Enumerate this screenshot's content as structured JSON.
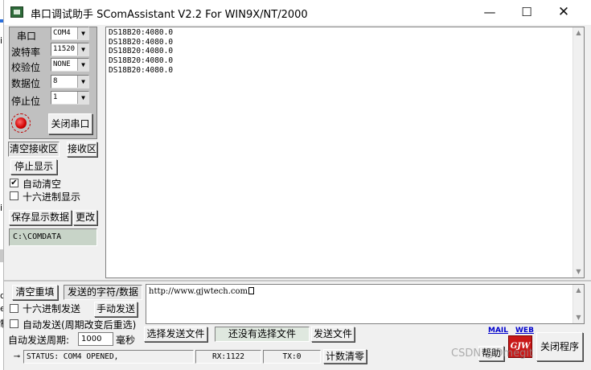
{
  "window": {
    "title": "串口调试助手 SComAssistant V2.2 For WIN9X/NT/2000",
    "minimize": "—",
    "maximize": "☐",
    "close": "✕"
  },
  "background": {
    "frag1": "i",
    "frag2": "i",
    "frag3": "d",
    "frag4": "e",
    "frag5": "制"
  },
  "serial": {
    "port_label": "串口",
    "port_value": "COM4",
    "baud_label": "波特率",
    "baud_value": "11520",
    "parity_label": "校验位",
    "parity_value": "NONE",
    "databits_label": "数据位",
    "databits_value": "8",
    "stopbits_label": "停止位",
    "stopbits_value": "1",
    "toggle_port_button": "关闭串口",
    "led_color": "#e00000"
  },
  "receive": {
    "clear_button": "清空接收区",
    "receive_area_button": "接收区",
    "stop_display_button": "停止显示",
    "auto_clear_label": "自动清空",
    "auto_clear_checked": true,
    "hex_display_label": "十六进制显示",
    "hex_display_checked": false,
    "save_button": "保存显示数据",
    "change_button": "更改",
    "save_path": "C:\\COMDATA",
    "lines": [
      "DS18B20:4080.0",
      "DS18B20:4080.0",
      "DS18B20:4080.0",
      "DS18B20:4080.0",
      "DS18B20:4080.0"
    ]
  },
  "send": {
    "clear_resend_button": "清空重填",
    "send_data_button": "发送的字符/数据",
    "hex_send_label": "十六进制发送",
    "manual_send_button": "手动发送",
    "auto_send_label": "自动发送(周期改变后重选)",
    "period_label": "自动发送周期:",
    "period_value": "1000",
    "period_unit": "毫秒",
    "choose_file_button": "选择发送文件",
    "no_file_text": "还没有选择文件",
    "send_file_button": "发送文件",
    "send_text": "http://www.gjwtech.com"
  },
  "links": {
    "mail": "MAIL",
    "web": "WEB"
  },
  "help_button": "帮助",
  "close_program_button": "关闭程序",
  "logo_text": "GJW",
  "status": {
    "pin": "⊸",
    "status_text": "STATUS: COM4 OPENED,",
    "rx": "RX:1122",
    "tx": "TX:0",
    "reset_count_button": "计数清零"
  },
  "watermark": "CSDN @Omegit"
}
